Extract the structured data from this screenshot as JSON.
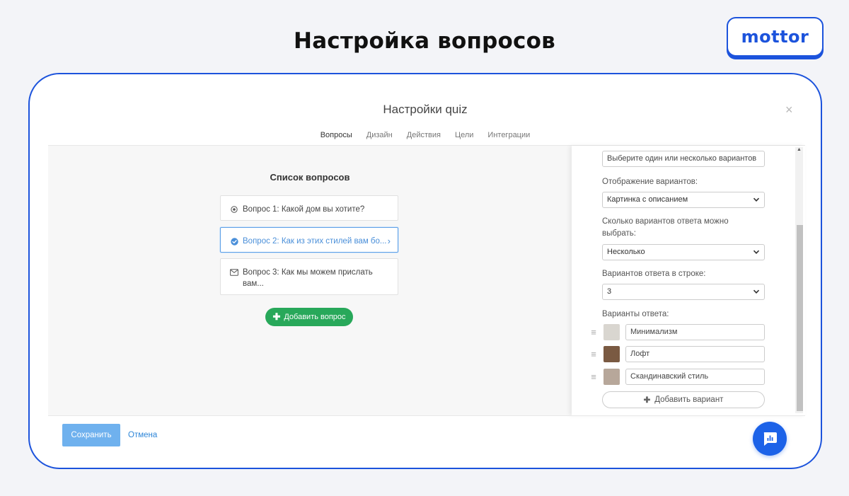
{
  "page_title": "Настройка вопросов",
  "logo": "mottor",
  "modal": {
    "title": "Настройки quiz",
    "close_label": "×",
    "tabs": [
      {
        "label": "Вопросы",
        "active": true
      },
      {
        "label": "Дизайн",
        "active": false
      },
      {
        "label": "Действия",
        "active": false
      },
      {
        "label": "Цели",
        "active": false
      },
      {
        "label": "Интеграции",
        "active": false
      }
    ]
  },
  "questions_list": {
    "title": "Список вопросов",
    "items": [
      {
        "text": "Вопрос 1: Какой дом вы хотите?",
        "icon": "radio-icon",
        "active": false
      },
      {
        "text": "Вопрос 2: Как из этих стилей вам бо...",
        "icon": "check-circle-icon",
        "active": true
      },
      {
        "text": "Вопрос 3: Как мы можем прислать вам...",
        "icon": "envelope-icon",
        "active": false
      }
    ],
    "add_button": "Добавить вопрос"
  },
  "settings": {
    "hint_value": "Выберите один или несколько вариантов",
    "display_label": "Отображение вариантов:",
    "display_value": "Картинка с описанием",
    "count_label": "Сколько вариантов ответа можно выбрать:",
    "count_value": "Несколько",
    "per_row_label": "Вариантов ответа в строке:",
    "per_row_value": "3",
    "options_label": "Варианты ответа:",
    "options": [
      {
        "value": "Минимализм",
        "thumb_color": "#d9d6d0"
      },
      {
        "value": "Лофт",
        "thumb_color": "#7a5a42"
      },
      {
        "value": "Скандинавский стиль",
        "thumb_color": "#b7a79a"
      }
    ],
    "add_option": "Добавить вариант"
  },
  "footer": {
    "save": "Сохранить",
    "cancel": "Отмена"
  },
  "colors": {
    "brand_blue": "#1c53dc",
    "accent_green": "#28a85a",
    "active_blue": "#4a8fd9",
    "save_blue": "#6fb1ee",
    "chat_blue": "#1c62e8"
  }
}
